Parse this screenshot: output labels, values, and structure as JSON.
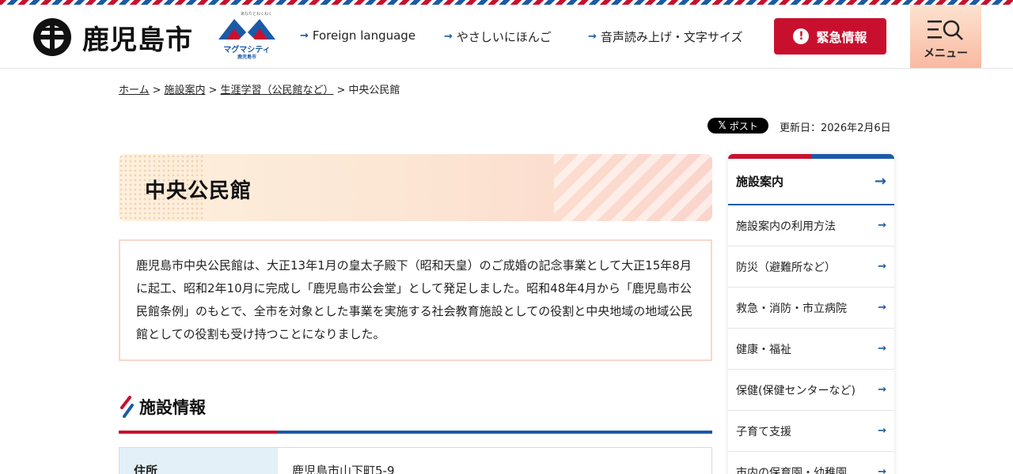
{
  "header": {
    "site_name": "鹿児島市",
    "sub_logo_label": "マグマシティ",
    "sub_logo_city": "鹿児島市",
    "sub_logo_tagline": "あなたとわくわく",
    "util_links": [
      {
        "label": "Foreign language"
      },
      {
        "label": "やさしいにほんご"
      },
      {
        "label": "音声読み上げ・文字サイズ"
      }
    ],
    "emergency_label": "緊急情報",
    "menu_label": "メニュー"
  },
  "breadcrumb": {
    "items": [
      "ホーム",
      "施設案内",
      "生涯学習（公民館など）"
    ],
    "current": "中央公民館",
    "separator": ">"
  },
  "share": {
    "post_label": "ポスト",
    "post_logo": "𝕏",
    "updated": "更新日：2026年2月6日"
  },
  "main": {
    "title": "中央公民館",
    "intro": "鹿児島市中央公民館は、大正13年1月の皇太子殿下（昭和天皇）のご成婚の記念事業として大正15年8月に起工、昭和2年10月に完成し「鹿児島市公会堂」として発足しました。昭和48年4月から「鹿児島市公民館条例」のもとで、全市を対象とした事業を実施する社会教育施設としての役割と中央地域の地域公民館としての役割も受け持つことになりました。",
    "section_title": "施設情報",
    "table": [
      {
        "label": "住所",
        "value": "鹿児島市山下町5-9"
      }
    ]
  },
  "sidebar": {
    "heading": "施設案内",
    "items": [
      {
        "label": "施設案内の利用方法"
      },
      {
        "label": "防災（避難所など）"
      },
      {
        "label": "救急・消防・市立病院"
      },
      {
        "label": "健康・福祉"
      },
      {
        "label": "保健(保健センターなど)"
      },
      {
        "label": "子育て支援"
      },
      {
        "label": "市内の保育園・幼稚園"
      }
    ]
  },
  "colors": {
    "brand_red": "#c8102e",
    "brand_blue": "#1b5aa6"
  }
}
